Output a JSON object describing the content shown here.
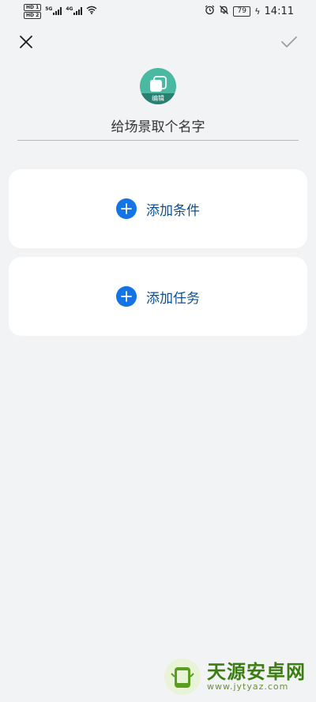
{
  "status_bar": {
    "sim1": "HD 1",
    "sim2": "HD 2",
    "net1": "5G",
    "net2": "4G",
    "battery": "79",
    "time": "14:11"
  },
  "top_bar": {
    "close_icon": "close-icon",
    "confirm_icon": "checkmark-icon"
  },
  "scene": {
    "icon": "scene-cards-icon",
    "edit_label": "编辑",
    "name_placeholder": "给场景取个名字",
    "name_value": ""
  },
  "cards": {
    "condition_label": "添加条件",
    "task_label": "添加任务"
  },
  "watermark": {
    "title": "天源安卓网",
    "url": "www.jytyaz.com"
  },
  "colors": {
    "background": "#f2f3f5",
    "card": "#ffffff",
    "accent_blue": "#1473e6",
    "label_blue": "#0c4f91",
    "scene_teal": "#49b9a2",
    "watermark_green": "#3b7d12"
  }
}
